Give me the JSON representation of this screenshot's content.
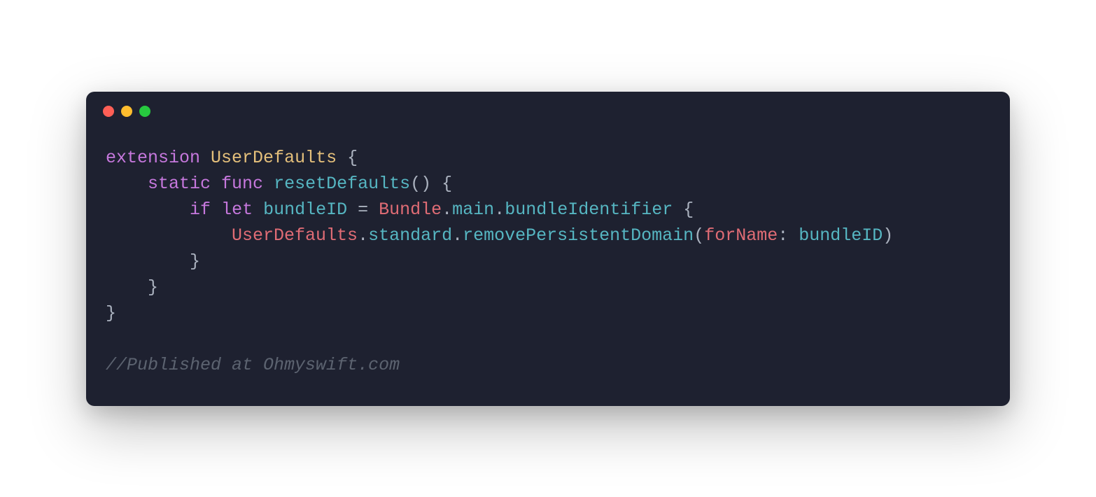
{
  "window": {
    "traffic_lights": [
      "red",
      "yellow",
      "green"
    ]
  },
  "code": {
    "line1": {
      "extension": "extension",
      "type": "UserDefaults",
      "brace_open": "{"
    },
    "line2": {
      "indent": "    ",
      "static": "static",
      "func": "func",
      "name": "resetDefaults",
      "parens": "()",
      "brace_open": "{"
    },
    "line3": {
      "indent": "        ",
      "if": "if",
      "let": "let",
      "var": "bundleID",
      "eq": " = ",
      "class": "Bundle",
      "dot1": ".",
      "prop1": "main",
      "dot2": ".",
      "prop2": "bundleIdentifier",
      "brace_open": " {"
    },
    "line4": {
      "indent": "            ",
      "class": "UserDefaults",
      "dot1": ".",
      "prop1": "standard",
      "dot2": ".",
      "method": "removePersistentDomain",
      "paren_open": "(",
      "label": "forName",
      "colon": ": ",
      "arg": "bundleID",
      "paren_close": ")"
    },
    "line5": {
      "indent": "        ",
      "brace_close": "}"
    },
    "line6": {
      "indent": "    ",
      "brace_close": "}"
    },
    "line7": {
      "brace_close": "}"
    },
    "blank": "",
    "comment_line": "//Published at Ohmyswift.com"
  }
}
